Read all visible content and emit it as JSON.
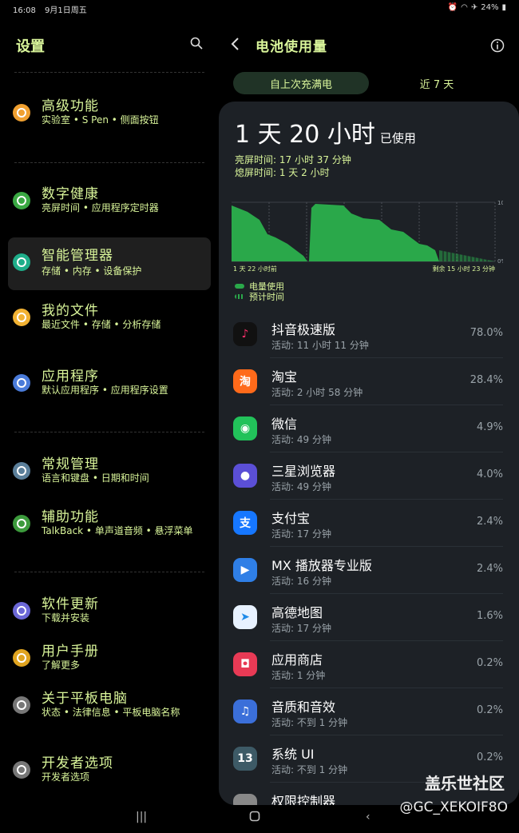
{
  "status_bar": {
    "time": "16:08",
    "date": "9月1日周五",
    "battery": "24%"
  },
  "settings": {
    "title": "设置",
    "items": [
      {
        "title": "高级功能",
        "sub": "实验室 • S Pen • 侧面按钮",
        "color": "#f0a030",
        "icon": "gear-plus-icon"
      },
      {
        "title": "数字健康",
        "sub": "亮屏时间 • 应用程序定时器",
        "color": "#3aa843",
        "icon": "heart-ring-icon"
      },
      {
        "title": "智能管理器",
        "sub": "存储 • 内存 • 设备保护",
        "color": "#1fae8a",
        "icon": "gauge-icon"
      },
      {
        "title": "我的文件",
        "sub": "最近文件 • 存储 • 分析存储",
        "color": "#f2b233",
        "icon": "folder-icon"
      },
      {
        "title": "应用程序",
        "sub": "默认应用程序 • 应用程序设置",
        "color": "#4a7bd9",
        "icon": "apps-grid-icon"
      },
      {
        "title": "常规管理",
        "sub": "语言和键盘 • 日期和时间",
        "color": "#5b7f9a",
        "icon": "sliders-icon"
      },
      {
        "title": "辅助功能",
        "sub": "TalkBack • 单声道音频 • 悬浮菜单",
        "color": "#3c9a3c",
        "icon": "accessibility-icon"
      },
      {
        "title": "软件更新",
        "sub": "下载并安装",
        "color": "#6b67d6",
        "icon": "update-icon"
      },
      {
        "title": "用户手册",
        "sub": "了解更多",
        "color": "#e0a420",
        "icon": "manual-icon"
      },
      {
        "title": "关于平板电脑",
        "sub": "状态 • 法律信息 • 平板电脑名称",
        "color": "#777777",
        "icon": "info-circle-icon"
      },
      {
        "title": "开发者选项",
        "sub": "开发者选项",
        "color": "#777777",
        "icon": "braces-icon"
      }
    ]
  },
  "battery": {
    "title": "电池使用量",
    "tabs": [
      "自上次充满电",
      "近 7 天"
    ],
    "usage_big": "1 天 20 小时",
    "usage_suffix": "已使用",
    "screen_on": "亮屏时间: 17 小时 37 分钟",
    "screen_off": "熄屏时间: 1 天 2 小时",
    "chart_start_label": "1 天 22 小时前",
    "chart_end_label": "剩余 15 小时 23 分钟",
    "chart_top_label": "100",
    "chart_bottom_label": "0%",
    "legend_usage": "电量使用",
    "legend_predict": "预计时间",
    "apps": [
      {
        "name": "抖音极速版",
        "act": "活动: 11 小时 11 分钟",
        "pct": "78.0%",
        "bg": "#111111",
        "fg": "#ff2f6b",
        "glyph": "♪",
        "icon": "douyin-icon"
      },
      {
        "name": "淘宝",
        "act": "活动: 2 小时 58 分钟",
        "pct": "28.4%",
        "bg": "#ff6a1a",
        "fg": "#ffffff",
        "glyph": "淘",
        "icon": "taobao-icon"
      },
      {
        "name": "微信",
        "act": "活动: 49 分钟",
        "pct": "4.9%",
        "bg": "#22c25a",
        "fg": "#ffffff",
        "glyph": "◉",
        "icon": "wechat-icon"
      },
      {
        "name": "三星浏览器",
        "act": "活动: 49 分钟",
        "pct": "4.0%",
        "bg": "#5b4fd6",
        "fg": "#ffffff",
        "glyph": "●",
        "icon": "browser-icon"
      },
      {
        "name": "支付宝",
        "act": "活动: 17 分钟",
        "pct": "2.4%",
        "bg": "#1677ff",
        "fg": "#ffffff",
        "glyph": "支",
        "icon": "alipay-icon"
      },
      {
        "name": "MX 播放器专业版",
        "act": "活动: 16 分钟",
        "pct": "2.4%",
        "bg": "#2f7fe6",
        "fg": "#ffffff",
        "glyph": "▶",
        "icon": "mx-player-icon"
      },
      {
        "name": "高德地图",
        "act": "活动: 17 分钟",
        "pct": "1.6%",
        "bg": "#e8f2ff",
        "fg": "#1f8ae8",
        "glyph": "➤",
        "icon": "amap-icon"
      },
      {
        "name": "应用商店",
        "act": "活动: 1 分钟",
        "pct": "0.2%",
        "bg": "#e83a55",
        "fg": "#ffffff",
        "glyph": "◘",
        "icon": "store-icon"
      },
      {
        "name": "音质和音效",
        "act": "活动: 不到 1 分钟",
        "pct": "0.2%",
        "bg": "#3b6fd9",
        "fg": "#ffffff",
        "glyph": "♫",
        "icon": "sound-icon"
      },
      {
        "name": "系统 UI",
        "act": "活动: 不到 1 分钟",
        "pct": "0.2%",
        "bg": "#3d5a66",
        "fg": "#ffffff",
        "glyph": "13",
        "icon": "system-ui-icon"
      },
      {
        "name": "权限控制器",
        "act": "",
        "pct": "",
        "bg": "#888888",
        "fg": "#ffffff",
        "glyph": "",
        "icon": "permission-icon"
      }
    ]
  },
  "watermark": "盖乐世社区",
  "watermark_user": "@GC_XEKOIF8O"
}
